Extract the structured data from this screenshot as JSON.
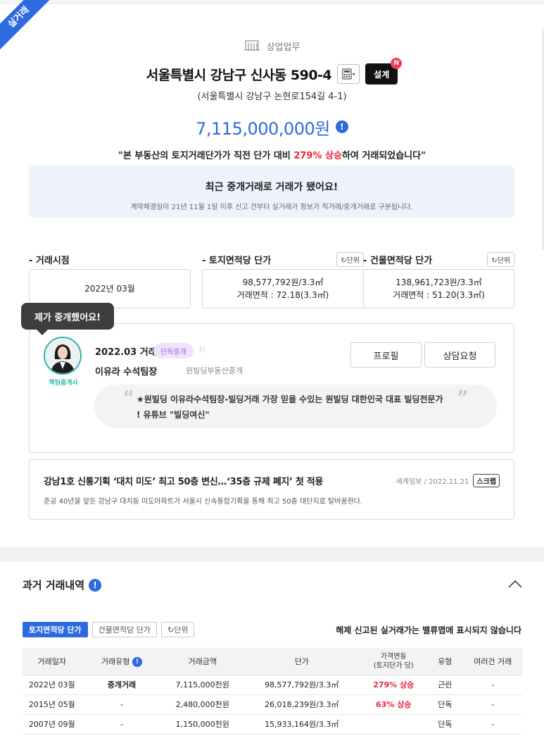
{
  "ribbon": "실거래",
  "header": {
    "category": "상업업무",
    "address": "서울특별시 강남구 신사동 590-4",
    "design_button": "설계",
    "design_badge": "N",
    "road_address": "(서울특별시 강남구 논현로154길 4-1)",
    "price": "7,115,000,000원",
    "note_prefix": "\"본 부동산의 토지거래단가가 직전 단가 대비 ",
    "note_highlight": "279% 상승",
    "note_suffix": "하여 거래되었습니다\""
  },
  "notice": {
    "title": "최근 중개거래로 거래가 됐어요!",
    "subtitle": "계약체결일이 21년 11월 1일 이후 신고 건부터 실거래가 정보가 직거래/중개거래로 구분됩니다."
  },
  "info": {
    "unit_label": "단위",
    "deal_time": {
      "label": "- 거래시점",
      "value": "2022년 03월"
    },
    "land_price": {
      "label": "- 토지면적당 단가",
      "value": "98,577,792원/3.3㎡",
      "area": "거래면적 : 72.18(3.3㎡)"
    },
    "building_price": {
      "label": "- 건물면적당 단가",
      "value": "138,961,723원/3.3㎡",
      "area": "거래면적 : 51.20(3.3㎡)"
    }
  },
  "agent": {
    "tooltip": "제가 중개했어요!",
    "caption": "책임중개사",
    "deal_date": "2022.03 거래",
    "tag": "단독중개",
    "name": "이유라 수석팀장",
    "office": "원빌딩부동산중개",
    "profile_button": "프로필",
    "consult_button": "상담요청",
    "quote_line1": "★원빌딩 이유라수석팀장-빌딩거래 가장 믿을 수있는 원빌딩 대한민국 대표 빌딩전문가",
    "quote_line2": "! 유튜브 \"빌딩여신\""
  },
  "news": {
    "title": "강남1호 신통기획 ‘대치 미도’ 최고 50층 변신…‘35층 규제 폐지’ 첫 적용",
    "source": "세계일보 / 2022.11.21",
    "scrap": "스크랩",
    "desc": "준공 40년을 앞둔 강남구 대치동 미도아파트가 서울시 신속통합기획을 통해 최고 50층 대단지로 탈바꿈한다."
  },
  "history": {
    "title": "과거 거래내역",
    "tab_land": "토지면적당 단가",
    "tab_building": "건물면적당 단가",
    "unit": "단위",
    "note": "해제 신고된 실거래가는 밸류맵에 표시되지 않습니다",
    "headers": {
      "date": "거래일자",
      "type": "거래유형",
      "amount": "거래금액",
      "unit_price": "단가",
      "change_line1": "가격변동",
      "change_line2": "(토지단가 당)",
      "kind": "유형",
      "multi": "여러건 거래"
    },
    "rows": [
      {
        "date": "2022년 03월",
        "type": "중개거래",
        "amount": "7,115,000천원",
        "unit_price": "98,577,792원/3.3㎡",
        "change": "279% 상승",
        "kind": "근린",
        "multi": "-"
      },
      {
        "date": "2015년 05월",
        "type": "-",
        "amount": "2,480,000천원",
        "unit_price": "26,018,239원/3.3㎡",
        "change": "63% 상승",
        "kind": "단독",
        "multi": "-"
      },
      {
        "date": "2007년 09월",
        "type": "-",
        "amount": "1,150,000천원",
        "unit_price": "15,933,164원/3.3㎡",
        "change": "",
        "kind": "단독",
        "multi": "-"
      }
    ]
  }
}
